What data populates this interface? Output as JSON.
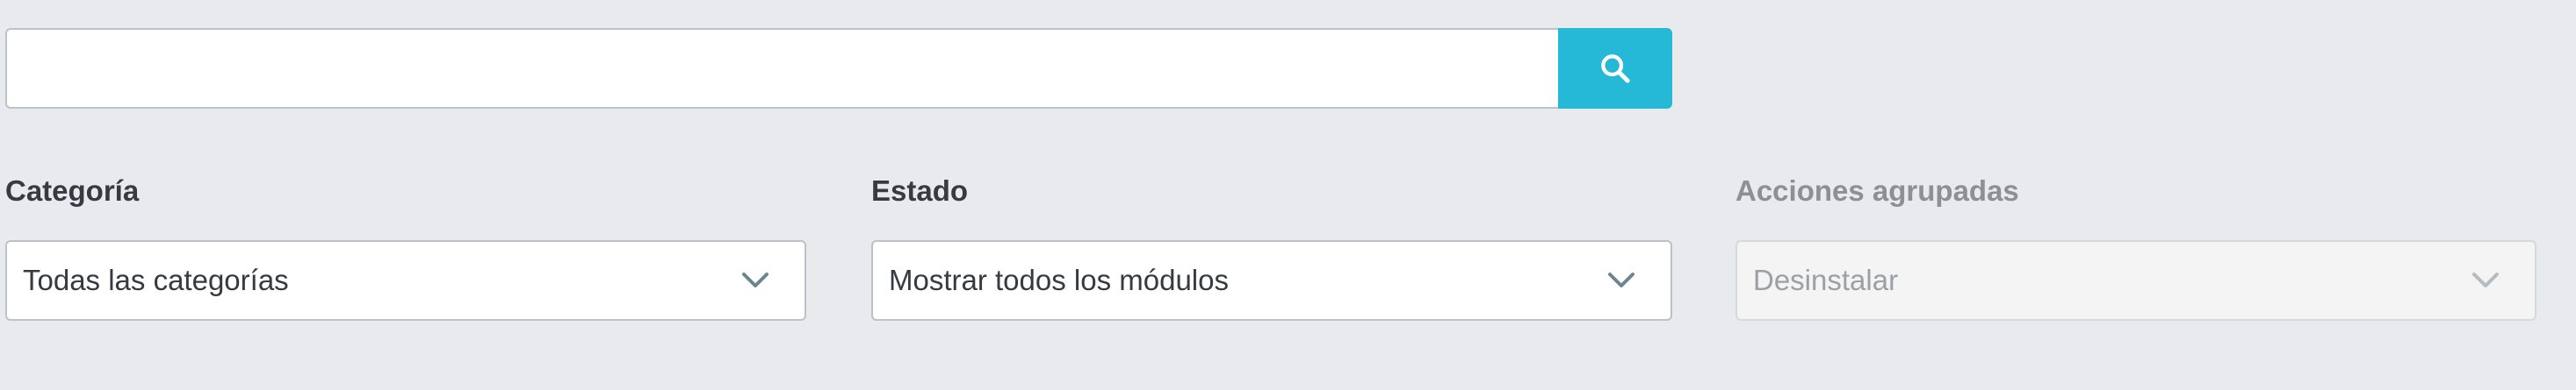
{
  "search": {
    "value": "",
    "placeholder": "",
    "button_icon": "search-icon",
    "button_color": "#25b9d7"
  },
  "filters": {
    "category": {
      "label": "Categoría",
      "selected": "Todas las categorías",
      "enabled": true
    },
    "status": {
      "label": "Estado",
      "selected": "Mostrar todos los módulos",
      "enabled": true
    },
    "bulk_actions": {
      "label": "Acciones agrupadas",
      "selected": "Desinstalar",
      "enabled": false
    }
  },
  "colors": {
    "background": "#e9eaed",
    "text": "#363a41",
    "disabled_text": "#8c9094",
    "chevron": "#6c868e"
  }
}
